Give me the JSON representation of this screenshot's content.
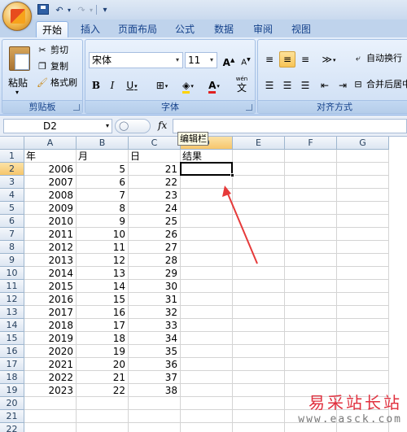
{
  "tabs": [
    "开始",
    "插入",
    "页面布局",
    "公式",
    "数据",
    "审阅",
    "视图"
  ],
  "active_tab": "开始",
  "clipboard": {
    "paste_label": "粘贴",
    "cut_label": "剪切",
    "copy_label": "复制",
    "format_painter_label": "格式刷",
    "group_label": "剪贴板"
  },
  "font": {
    "font_name": "宋体",
    "font_size": "11",
    "bold": "B",
    "italic": "I",
    "underline": "U",
    "font_color_glyph": "A",
    "wen_glyph": "文",
    "wen_top": "wén",
    "grow": "A",
    "shrink": "A",
    "group_label": "字体"
  },
  "alignment": {
    "wrap_text_label": "自动换行",
    "merge_label": "合并后居中",
    "group_label": "对齐方式"
  },
  "formula_bar": {
    "name_box": "D2",
    "fx": "fx",
    "tooltip": "编辑栏"
  },
  "columns": [
    "A",
    "B",
    "C",
    "D",
    "E",
    "F",
    "G"
  ],
  "rows": [
    "1",
    "2",
    "3",
    "4",
    "5",
    "6",
    "7",
    "8",
    "9",
    "10",
    "11",
    "12",
    "13",
    "14",
    "15",
    "16",
    "17",
    "18",
    "19",
    "20",
    "21",
    "22"
  ],
  "headers": {
    "A": "年",
    "B": "月",
    "C": "日",
    "D": "结果"
  },
  "data_rows": [
    [
      "2006",
      "5",
      "21"
    ],
    [
      "2007",
      "6",
      "22"
    ],
    [
      "2008",
      "7",
      "23"
    ],
    [
      "2009",
      "8",
      "24"
    ],
    [
      "2010",
      "9",
      "25"
    ],
    [
      "2011",
      "10",
      "26"
    ],
    [
      "2012",
      "11",
      "27"
    ],
    [
      "2013",
      "12",
      "28"
    ],
    [
      "2014",
      "13",
      "29"
    ],
    [
      "2015",
      "14",
      "30"
    ],
    [
      "2016",
      "15",
      "31"
    ],
    [
      "2017",
      "16",
      "32"
    ],
    [
      "2018",
      "17",
      "33"
    ],
    [
      "2019",
      "18",
      "34"
    ],
    [
      "2020",
      "19",
      "35"
    ],
    [
      "2021",
      "20",
      "36"
    ],
    [
      "2022",
      "21",
      "37"
    ],
    [
      "2023",
      "22",
      "38"
    ]
  ],
  "selected_cell": "D2",
  "watermark": {
    "text": "易采站长站",
    "url": "www.easck.com"
  },
  "colors": {
    "annotation_arrow": "#e63a3a",
    "selection_header": "#f6c66b",
    "ribbon": "#d5e4f7"
  }
}
